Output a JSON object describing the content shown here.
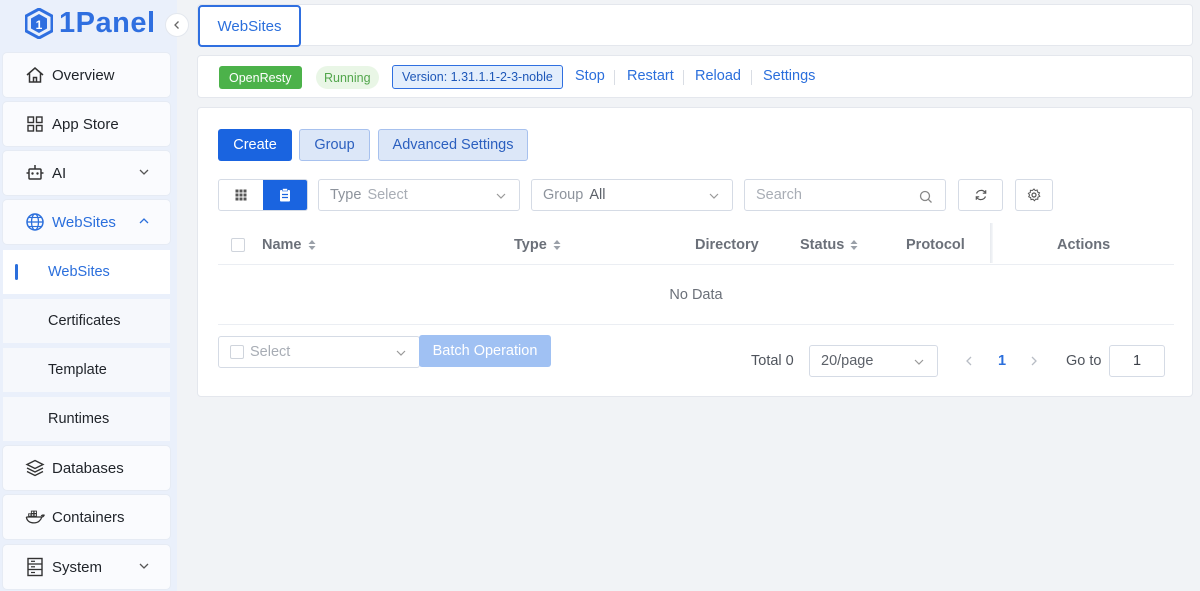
{
  "app": {
    "name": "1Panel"
  },
  "sidebar": {
    "collapse_icon": "chevron-left-icon",
    "items": [
      {
        "label": "Overview",
        "icon": "home-icon"
      },
      {
        "label": "App Store",
        "icon": "grid-icon"
      },
      {
        "label": "AI",
        "icon": "robot-icon",
        "expandable": true
      },
      {
        "label": "WebSites",
        "icon": "globe-icon",
        "expanded": true
      },
      {
        "label": "Databases",
        "icon": "layers-icon"
      },
      {
        "label": "Containers",
        "icon": "docker-icon"
      },
      {
        "label": "System",
        "icon": "server-icon",
        "expandable": true
      }
    ],
    "websites_children": [
      {
        "label": "WebSites",
        "current": true
      },
      {
        "label": "Certificates"
      },
      {
        "label": "Template"
      },
      {
        "label": "Runtimes"
      }
    ]
  },
  "tabs": [
    {
      "label": "WebSites",
      "active": true
    }
  ],
  "status": {
    "service": "OpenResty",
    "state": "Running",
    "version": "Version: 1.31.1.1-2-3-noble",
    "actions": [
      "Stop",
      "Restart",
      "Reload",
      "Settings"
    ]
  },
  "toolbar": {
    "create": "Create",
    "group": "Group",
    "advanced": "Advanced Settings"
  },
  "filters": {
    "type_label": "Type",
    "type_placeholder": "Select",
    "group_label": "Group",
    "group_value": "All",
    "search_placeholder": "Search"
  },
  "table": {
    "columns": [
      "Name",
      "Type",
      "Directory",
      "Status",
      "Protocol",
      "Actions"
    ],
    "empty_text": "No Data"
  },
  "footer": {
    "select_placeholder": "Select",
    "batch": "Batch Operation",
    "total": "Total 0",
    "page_size": "20/page",
    "current_page": "1",
    "goto_label": "Go to",
    "goto_value": "1"
  },
  "colors": {
    "primary": "#1a64e0",
    "running_green": "#4cb24a",
    "sidebar_bg": "#eaf0fb"
  }
}
